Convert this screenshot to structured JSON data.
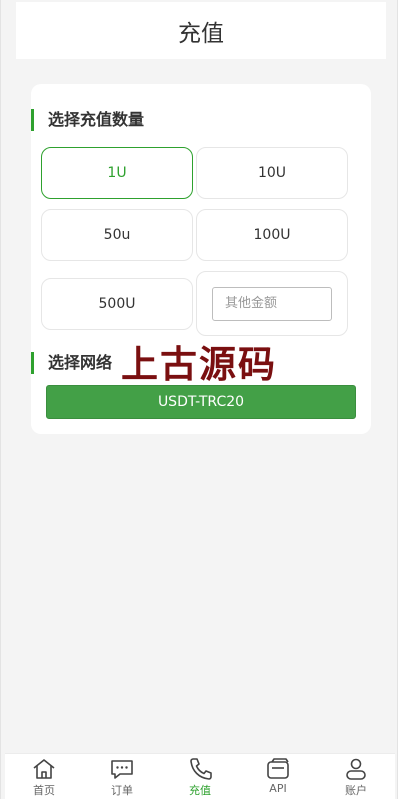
{
  "header": {
    "title": "充值"
  },
  "amount_section": {
    "title": "选择充值数量",
    "options": [
      {
        "label": "1U",
        "selected": true
      },
      {
        "label": "10U",
        "selected": false
      },
      {
        "label": "50u",
        "selected": false
      },
      {
        "label": "100U",
        "selected": false
      },
      {
        "label": "500U",
        "selected": false
      }
    ],
    "custom_placeholder": "其他金额",
    "custom_value": ""
  },
  "network_section": {
    "title": "选择网络",
    "button_label": "USDT-TRC20"
  },
  "watermark": "上古源码",
  "tabbar": {
    "items": [
      {
        "label": "首页",
        "icon": "home-icon",
        "active": false
      },
      {
        "label": "订单",
        "icon": "chat-bubble-icon",
        "active": false
      },
      {
        "label": "充值",
        "icon": "phone-icon",
        "active": true
      },
      {
        "label": "API",
        "icon": "card-icon",
        "active": false
      },
      {
        "label": "账户",
        "icon": "user-icon",
        "active": false
      }
    ]
  },
  "colors": {
    "accent": "#2ea12e",
    "button": "#43a047",
    "watermark": "#7a0f10"
  }
}
